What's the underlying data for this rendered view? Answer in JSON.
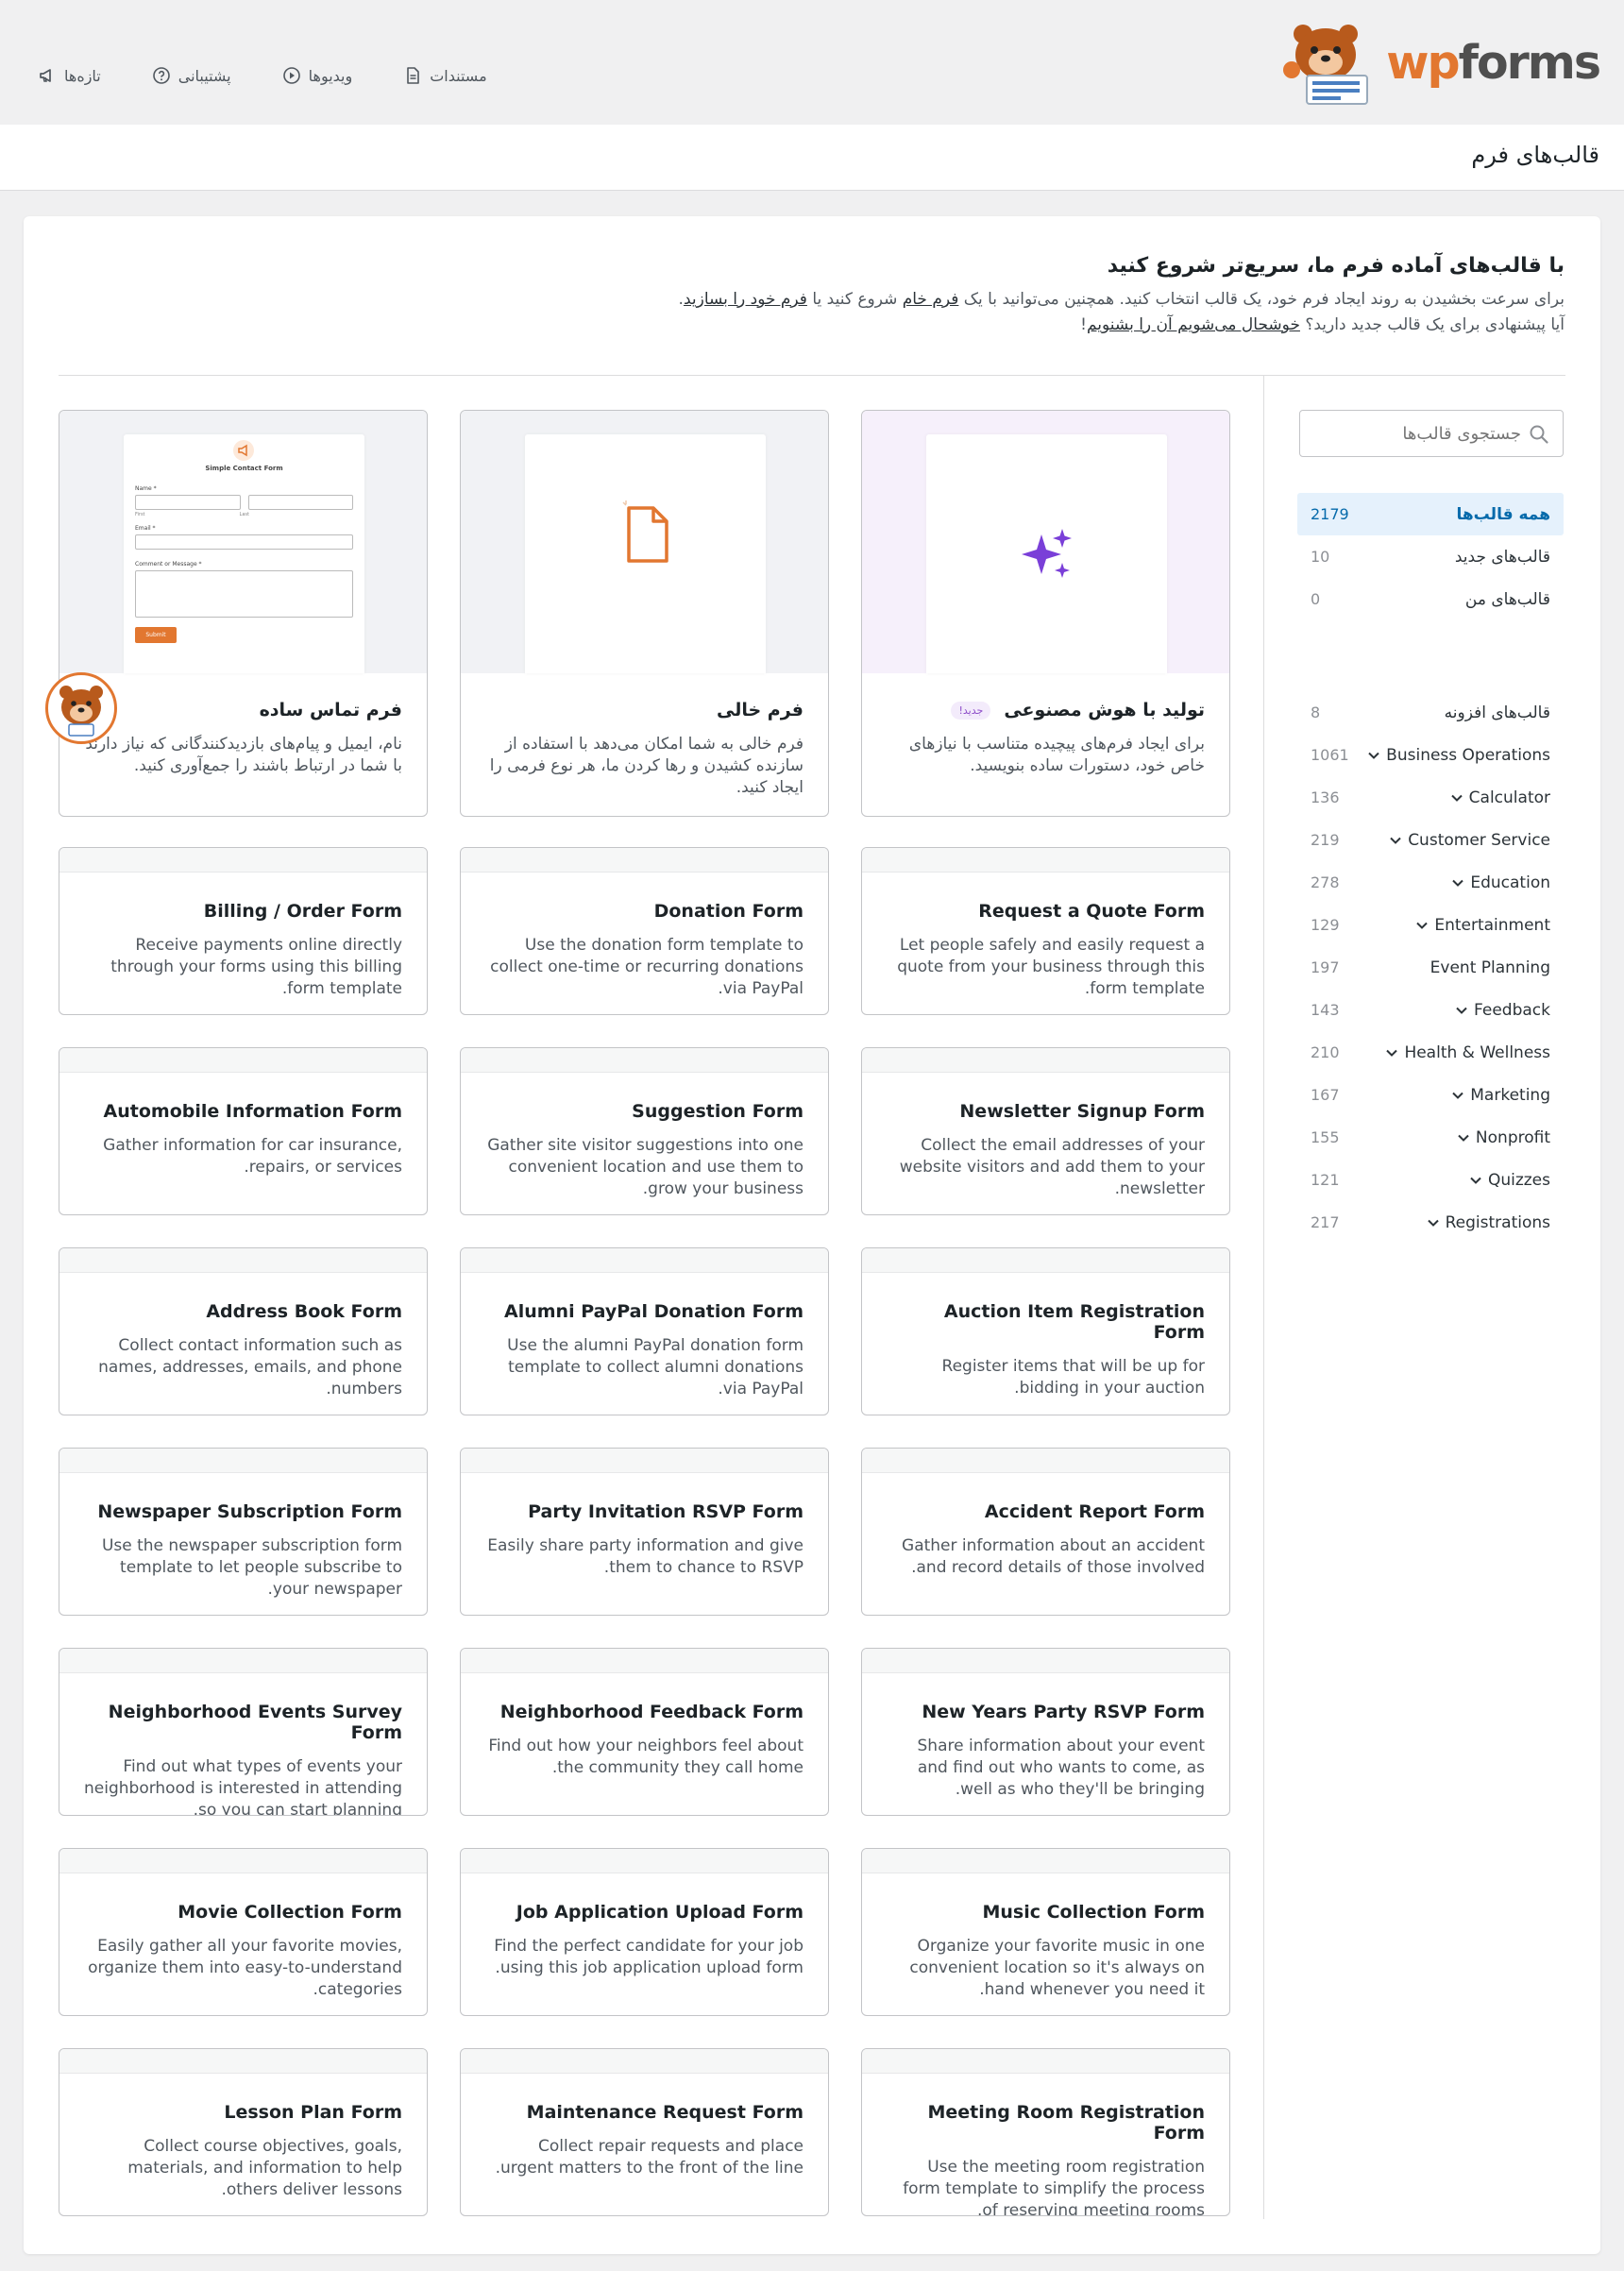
{
  "top_links": {
    "docs": "مستندات",
    "videos": "ویدیوها",
    "support": "پشتیبانی",
    "whats_new": "تازه‌ها"
  },
  "logo": {
    "wp": "wp",
    "forms": "forms"
  },
  "page_title": "قالب‌های فرم",
  "intro": {
    "heading": "با قالب‌های آماده فرم ما، سریع‌تر شروع کنید",
    "line1_a": "برای سرعت بخشیدن به روند ایجاد فرم خود، یک قالب انتخاب کنید. همچنین می‌توانید با یک ",
    "link_blank": "فرم خام",
    "line1_b": " شروع کنید یا ",
    "link_build": "فرم خود را بسازید",
    "line1_c": ".",
    "line2_a": "آیا پیشنهادی برای یک قالب جدید دارید؟ ",
    "link_suggest": "خوشحال می‌شویم آن را بشنویم",
    "line2_b": "!"
  },
  "search": {
    "placeholder": "جستجوی قالب‌ها"
  },
  "categories_top": [
    {
      "name": "همه قالب‌ها",
      "count": "2179"
    },
    {
      "name": "قالب‌های جدید",
      "count": "10"
    },
    {
      "name": "قالب‌های من",
      "count": "0"
    }
  ],
  "categories": [
    {
      "name": "قالب‌های افزونه",
      "count": "8",
      "has_children": false
    },
    {
      "name": "Business Operations",
      "count": "1061",
      "has_children": true
    },
    {
      "name": "Calculator",
      "count": "136",
      "has_children": true
    },
    {
      "name": "Customer Service",
      "count": "219",
      "has_children": true
    },
    {
      "name": "Education",
      "count": "278",
      "has_children": true
    },
    {
      "name": "Entertainment",
      "count": "129",
      "has_children": true
    },
    {
      "name": "Event Planning",
      "count": "197",
      "has_children": false
    },
    {
      "name": "Feedback",
      "count": "143",
      "has_children": true
    },
    {
      "name": "Health & Wellness",
      "count": "210",
      "has_children": true
    },
    {
      "name": "Marketing",
      "count": "167",
      "has_children": true
    },
    {
      "name": "Nonprofit",
      "count": "155",
      "has_children": true
    },
    {
      "name": "Quizzes",
      "count": "121",
      "has_children": true
    },
    {
      "name": "Registrations",
      "count": "217",
      "has_children": true
    }
  ],
  "featured": [
    {
      "title": "تولید با هوش مصنوعی",
      "badge": "جدید!",
      "desc": "برای ایجاد فرم‌های پیچیده متناسب با نیازهای خاص خود، دستورات ساده بنویسید."
    },
    {
      "title": "فرم خالی",
      "desc": "فرم خالی به شما امکان می‌دهد با استفاده از سازنده کشیدن و رها کردن ما، هر نوع فرمی را ایجاد کنید."
    },
    {
      "title": "فرم تماس ساده",
      "desc": "نام، ایمیل و پیام‌های بازدیدکنندگانی که نیاز دارند با شما در ارتباط باشند را جمع‌آوری کنید."
    }
  ],
  "mini_form": {
    "title": "Simple Contact Form",
    "name_label": "Name *",
    "first": "First",
    "last": "Last",
    "email_label": "Email *",
    "message_label": "Comment or Message *",
    "submit": "Submit"
  },
  "templates": [
    {
      "title": "Request a Quote Form",
      "desc": "Let people safely and easily request a quote from your business through this form template."
    },
    {
      "title": "Donation Form",
      "desc": "Use the donation form template to collect one-time or recurring donations via PayPal."
    },
    {
      "title": "Billing / Order Form",
      "desc": "Receive payments online directly through your forms using this billing form template."
    },
    {
      "title": "Newsletter Signup Form",
      "desc": "Collect the email addresses of your website visitors and add them to your newsletter."
    },
    {
      "title": "Suggestion Form",
      "desc": "Gather site visitor suggestions into one convenient location and use them to grow your business."
    },
    {
      "title": "Automobile Information Form",
      "desc": "Gather information for car insurance, repairs, or services."
    },
    {
      "title": "Auction Item Registration Form",
      "desc": "Register items that will be up for bidding in your auction."
    },
    {
      "title": "Alumni PayPal Donation Form",
      "desc": "Use the alumni PayPal donation form template to collect alumni donations via PayPal."
    },
    {
      "title": "Address Book Form",
      "desc": "Collect contact information such as names, addresses, emails, and phone numbers."
    },
    {
      "title": "Accident Report Form",
      "desc": "Gather information about an accident and record details of those involved."
    },
    {
      "title": "Party Invitation RSVP Form",
      "desc": "Easily share party information and give them to chance to RSVP."
    },
    {
      "title": "Newspaper Subscription Form",
      "desc": "Use the newspaper subscription form template to let people subscribe to your newspaper."
    },
    {
      "title": "New Years Party RSVP Form",
      "desc": "Share information about your event and find out who wants to come, as well as who they'll be bringing."
    },
    {
      "title": "Neighborhood Feedback Form",
      "desc": "Find out how your neighbors feel about the community they call home."
    },
    {
      "title": "Neighborhood Events Survey Form",
      "desc": "Find out what types of events your neighborhood is interested in attending so you can start planning."
    },
    {
      "title": "Music Collection Form",
      "desc": "Organize your favorite music in one convenient location so it's always on hand whenever you need it."
    },
    {
      "title": "Job Application Upload Form",
      "desc": "Find the perfect candidate for your job using this job application upload form."
    },
    {
      "title": "Movie Collection Form",
      "desc": "Easily gather all your favorite movies, organize them into easy-to-understand categories."
    },
    {
      "title": "Meeting Room Registration Form",
      "desc": "Use the meeting room registration form template to simplify the process of reserving meeting rooms."
    },
    {
      "title": "Maintenance Request Form",
      "desc": "Collect repair requests and place urgent matters to the front of the line."
    },
    {
      "title": "Lesson Plan Form",
      "desc": "Collect course objectives, goals, materials, and information to help others deliver lessons."
    }
  ],
  "colors": {
    "accent": "#e27730",
    "link": "#056aab",
    "ai_purple": "#7a3fd8"
  }
}
